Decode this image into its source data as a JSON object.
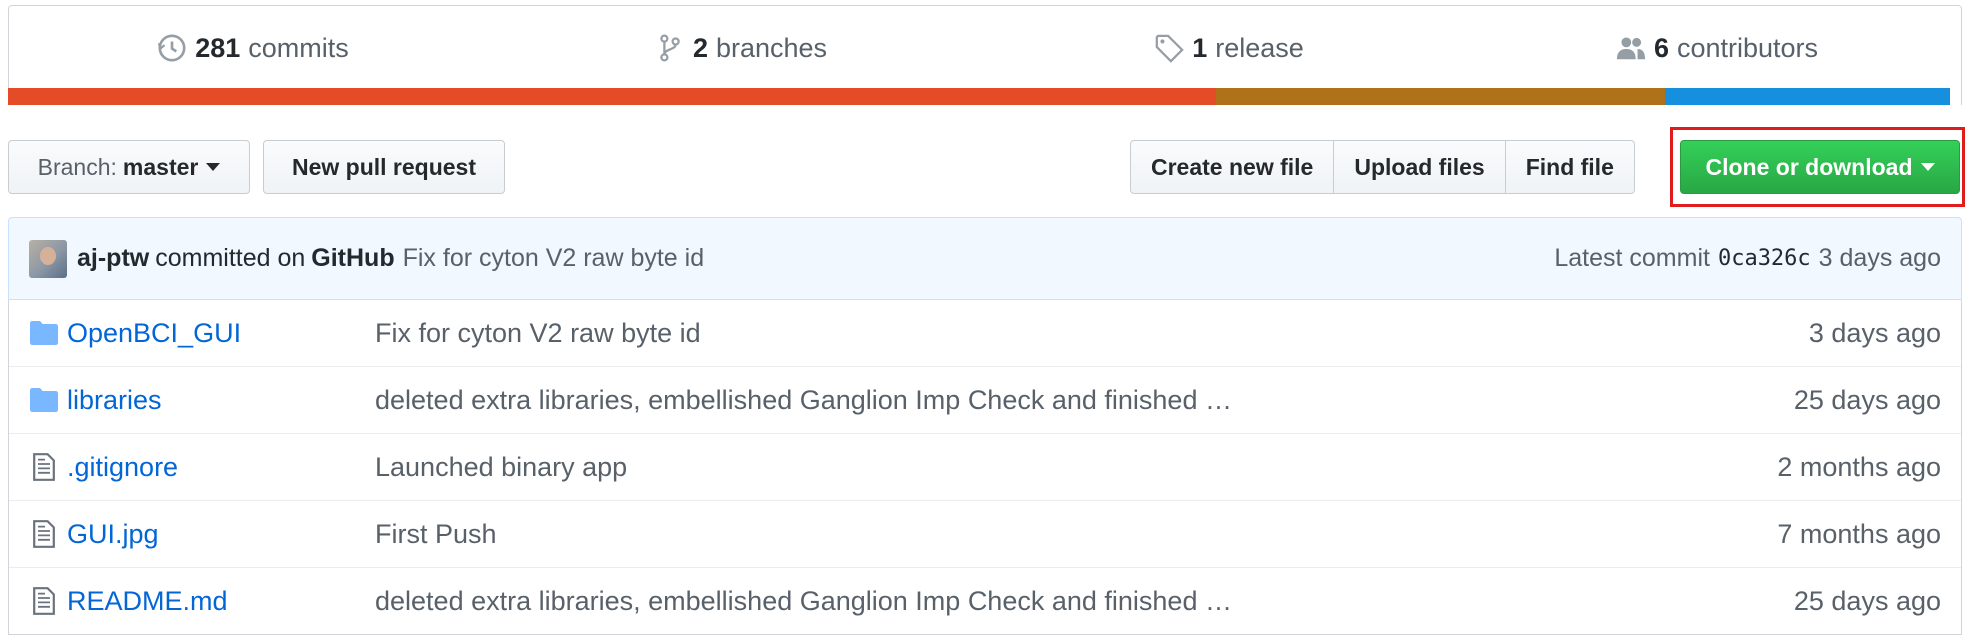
{
  "summary": {
    "commits": {
      "count": "281",
      "label": "commits"
    },
    "branches": {
      "count": "2",
      "label": "branches"
    },
    "releases": {
      "count": "1",
      "label": "release"
    },
    "contributors": {
      "count": "6",
      "label": "contributors"
    }
  },
  "language_bar": [
    {
      "color": "#e34c26",
      "fraction": 0.618
    },
    {
      "color": "#b07219",
      "fraction": 0.23
    },
    {
      "color": "#178fdf",
      "fraction": 0.146
    }
  ],
  "toolbar": {
    "branch_label": "Branch:",
    "branch_name": "master",
    "new_pr": "New pull request",
    "create_file": "Create new file",
    "upload_files": "Upload files",
    "find_file": "Find file",
    "clone": "Clone or download"
  },
  "commit": {
    "author": "aj-ptw",
    "action": "committed on",
    "platform": "GitHub",
    "message": "Fix for cyton V2 raw byte id",
    "latest_label": "Latest commit",
    "sha": "0ca326c",
    "age": "3 days ago"
  },
  "files": [
    {
      "type": "folder",
      "name": "OpenBCI_GUI",
      "message": "Fix for cyton V2 raw byte id",
      "age": "3 days ago"
    },
    {
      "type": "folder",
      "name": "libraries",
      "message": "deleted extra libraries, embellished Ganglion Imp Check and finished …",
      "age": "25 days ago"
    },
    {
      "type": "file",
      "name": ".gitignore",
      "message": "Launched binary app",
      "age": "2 months ago"
    },
    {
      "type": "file",
      "name": "GUI.jpg",
      "message": "First Push",
      "age": "7 months ago"
    },
    {
      "type": "file",
      "name": "README.md",
      "message": "deleted extra libraries, embellished Ganglion Imp Check and finished …",
      "age": "25 days ago"
    }
  ],
  "icons": {
    "commits": "history-icon",
    "branches": "git-branch-icon",
    "releases": "tag-icon",
    "contributors": "people-icon",
    "folder": "folder-icon",
    "file": "file-text-icon"
  }
}
